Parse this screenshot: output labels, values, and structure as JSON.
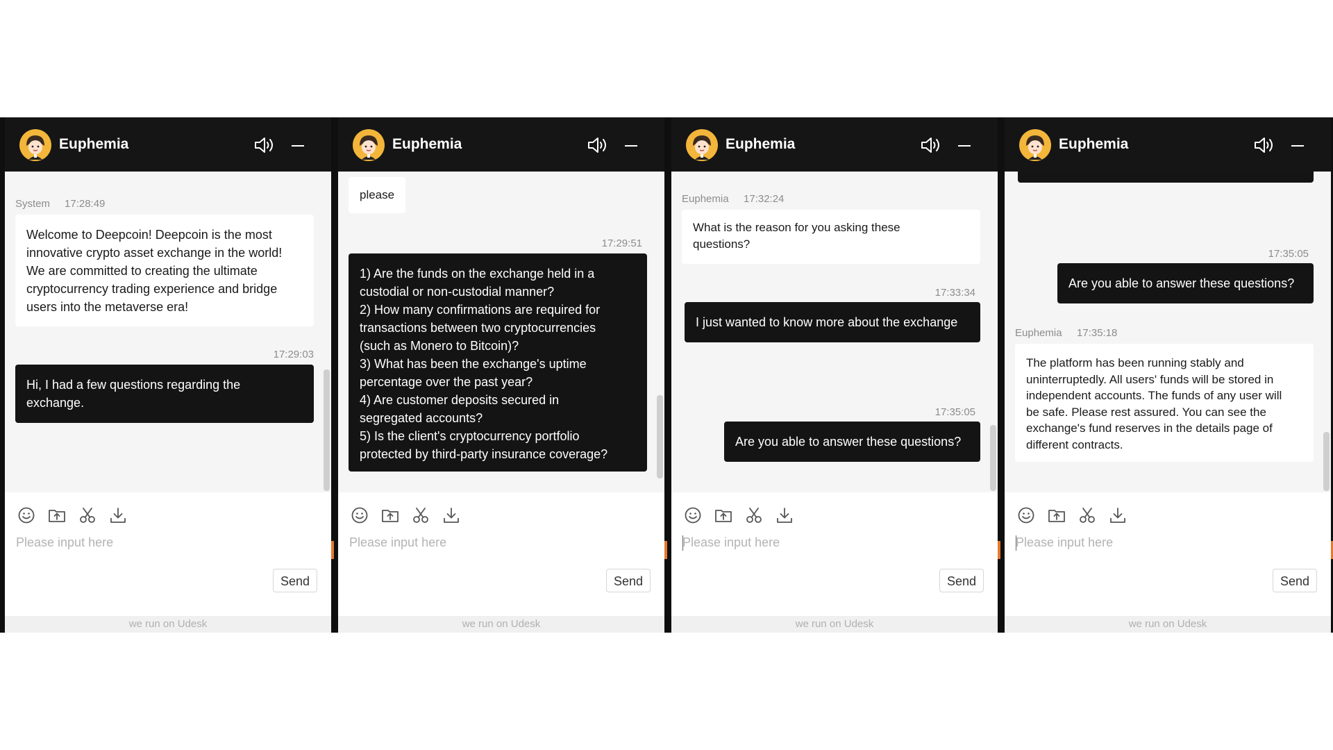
{
  "panels": [
    {
      "agent_name": "Euphemia",
      "messages": [
        {
          "sender": "System",
          "time": "17:28:49",
          "text": "Welcome to Deepcoin! Deepcoin is the most\ninnovative crypto asset exchange in the world!\nWe are committed to creating the ultimate\ncryptocurrency trading experience and bridge\nusers into the metaverse era!"
        },
        {
          "time": "17:29:03",
          "text": "Hi, I had a few questions regarding the\nexchange."
        }
      ],
      "input_placeholder": "Please input here",
      "send_label": "Send",
      "footer": "we run on Udesk"
    },
    {
      "agent_name": "Euphemia",
      "messages": [
        {
          "text": "please"
        },
        {
          "time": "17:29:51",
          "text": "1) Are the funds on the exchange held in a\ncustodial or non-custodial manner?\n2) How many confirmations are required for\ntransactions between two cryptocurrencies\n(such as Monero to Bitcoin)?\n3) What has been the exchange's uptime\npercentage over the past year?\n4) Are customer deposits secured in\nsegregated accounts?\n5) Is the client's cryptocurrency portfolio\nprotected by third-party insurance coverage?"
        }
      ],
      "input_placeholder": "Please input here",
      "send_label": "Send",
      "footer": "we run on Udesk"
    },
    {
      "agent_name": "Euphemia",
      "messages": [
        {
          "sender": "Euphemia",
          "time": "17:32:24",
          "text": "What is the reason for you asking these\nquestions?"
        },
        {
          "time": "17:33:34",
          "text": "I just wanted to know more about the exchange"
        },
        {
          "time": "17:35:05",
          "text": "Are you able to answer these questions?"
        }
      ],
      "input_placeholder": "Please input here",
      "send_label": "Send",
      "footer": "we run on Udesk"
    },
    {
      "agent_name": "Euphemia",
      "messages": [
        {
          "time": "17:35:05",
          "text": "Are you able to answer these questions?"
        },
        {
          "sender": "Euphemia",
          "time": "17:35:18",
          "text": "The platform has been running stably and\nuninterruptedly. All users' funds will be stored in\nindependent accounts. The funds of any user will\nbe safe. Please rest assured. You can see the\nexchange's fund reserves in the details page of\ndifferent contracts."
        }
      ],
      "input_placeholder": "Please input here",
      "send_label": "Send",
      "footer": "we run on Udesk"
    }
  ],
  "icons": [
    "avatar",
    "speaker-icon",
    "minimize-icon",
    "emoji-icon",
    "upload-folder-icon",
    "scissors-icon",
    "download-icon"
  ],
  "colors": {
    "header": "#151515",
    "chat_bg": "#f5f5f5",
    "outgoing_bubble": "#141414",
    "incoming_bubble": "#ffffff",
    "accent": "#e37a2e"
  }
}
